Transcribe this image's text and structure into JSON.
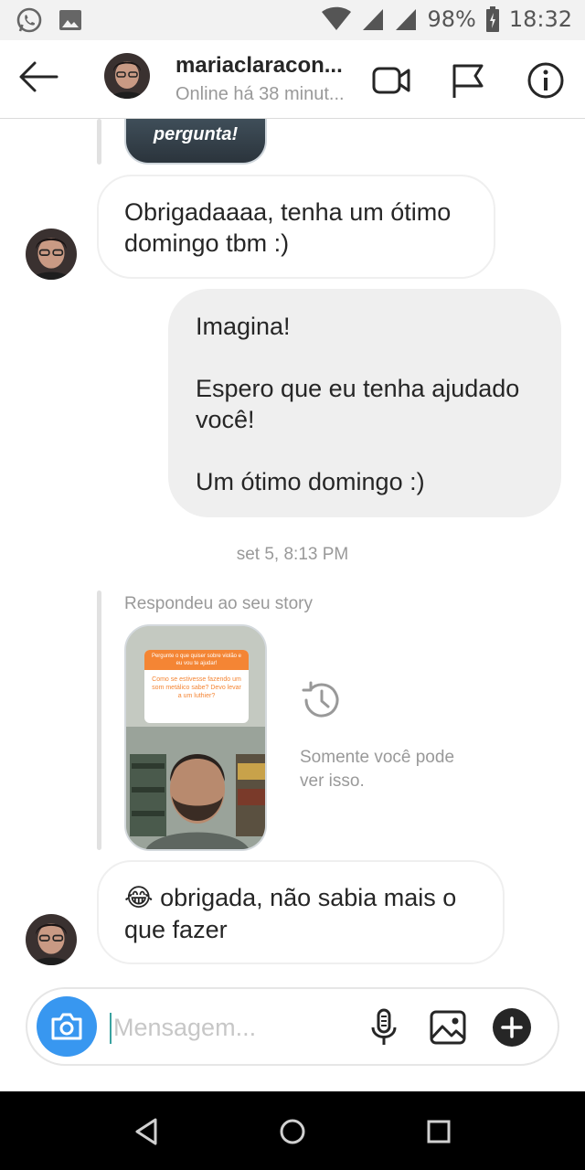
{
  "status_bar": {
    "battery": "98%",
    "time": "18:32",
    "icons": [
      "whatsapp-icon",
      "gallery-icon",
      "wifi-icon",
      "signal-icon",
      "signal-icon",
      "battery-charging-icon"
    ]
  },
  "header": {
    "username": "mariaclaracon...",
    "status": "Online há 38 minut...",
    "icons": [
      "back-arrow-icon",
      "video-call-icon",
      "flag-icon",
      "info-icon"
    ]
  },
  "story_top": {
    "label": "pergunta!"
  },
  "messages": [
    {
      "side": "in",
      "text": "Obrigadaaaa, tenha um ótimo domingo tbm :)"
    },
    {
      "side": "out",
      "text": "Imagina!\n\nEspero que eu tenha ajudado você!\n\nUm ótimo domingo :)"
    }
  ],
  "timestamp": "set 5, 8:13 PM",
  "story_reply": {
    "caption": "Respondeu ao seu story",
    "question_header": "Pergunte o que quiser sobre violão e eu vou te ajudar!",
    "question_body": "Como se estivesse fazendo um som metálico sabe? Devo levar a um luthier?",
    "hidden_note": "Somente você pode ver isso."
  },
  "last_message": {
    "emoji": "😂",
    "text": " obrigada, não sabia mais o que fazer"
  },
  "composer": {
    "placeholder": "Mensagem..."
  },
  "colors": {
    "accent_blue": "#3897f0",
    "bubble_out": "#efefef",
    "muted_text": "#999999"
  }
}
